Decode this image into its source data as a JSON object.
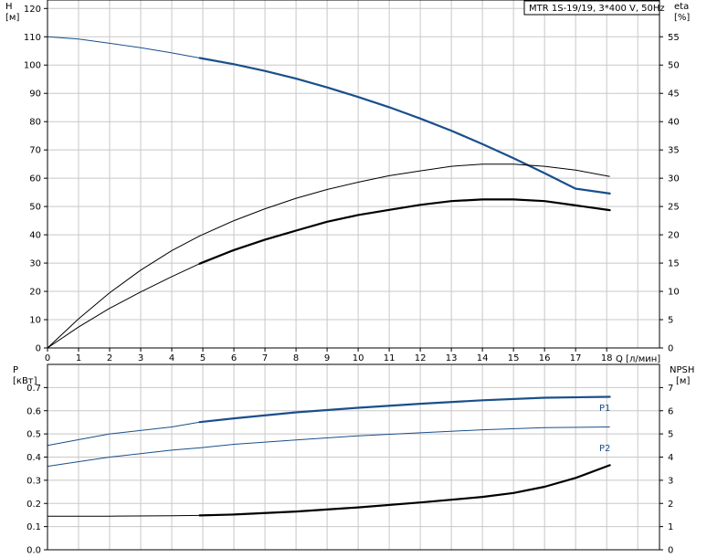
{
  "colors": {
    "blue": "#1a4f8b",
    "black": "#000000",
    "grid": "#c8c8c8",
    "frame": "#000000"
  },
  "title": "MTR 1S-19/19, 3*400 V, 50Hz",
  "chart_data": [
    {
      "type": "line",
      "grid": true,
      "x_axis": {
        "label": "Q [л/мин]",
        "range": [
          0,
          19.7
        ],
        "ticks": [
          "0",
          "1",
          "2",
          "3",
          "4",
          "5",
          "6",
          "7",
          "8",
          "9",
          "10",
          "11",
          "12",
          "13",
          "14",
          "15",
          "16",
          "17",
          "18"
        ]
      },
      "left_axis": {
        "label_line1": "H",
        "label_line2": "[м]",
        "range": [
          0,
          123
        ],
        "ticks": [
          "0",
          "10",
          "20",
          "30",
          "40",
          "50",
          "60",
          "70",
          "80",
          "90",
          "100",
          "110",
          "120"
        ]
      },
      "right_axis": {
        "label_line1": "eta",
        "label_line2": "[%]",
        "range": [
          0,
          61.5
        ],
        "ticks": [
          "0",
          "5",
          "10",
          "15",
          "20",
          "25",
          "30",
          "35",
          "40",
          "45",
          "50",
          "55"
        ]
      },
      "series": [
        {
          "axis": "left",
          "color": "#1a4f8b",
          "x": [
            0,
            1,
            2,
            3,
            4,
            4.9,
            6,
            7,
            8,
            9,
            10,
            11,
            12,
            13,
            14,
            15,
            16,
            17,
            18.1
          ],
          "y": [
            110,
            109.2,
            107.7,
            106.1,
            104.3,
            102.5,
            100.3,
            97.9,
            95.2,
            92.1,
            88.7,
            85.1,
            81.1,
            76.8,
            72.1,
            67.1,
            61.8,
            56.3,
            54.6
          ],
          "highlight_from": 4.9
        },
        {
          "axis": "left",
          "color": "#000000",
          "x": [
            0,
            1,
            2,
            3,
            4,
            4.9,
            6,
            7,
            8,
            9,
            10,
            11,
            12,
            13,
            14,
            15,
            16,
            17,
            18.1
          ],
          "y": [
            0,
            10.3,
            19.5,
            27.5,
            34.4,
            39.6,
            45.0,
            49.2,
            52.9,
            56.0,
            58.6,
            60.9,
            62.6,
            64.2,
            65.0,
            65.0,
            64.2,
            62.9,
            60.6
          ],
          "highlight_from": 99
        },
        {
          "axis": "left",
          "color": "#000000",
          "x": [
            0,
            1,
            2,
            3,
            4,
            4.9,
            6,
            7,
            8,
            9,
            10,
            11,
            12,
            13,
            14,
            15,
            16,
            17,
            18.1
          ],
          "y": [
            0,
            7.4,
            14.0,
            19.8,
            25.2,
            29.8,
            34.6,
            38.3,
            41.5,
            44.6,
            47.0,
            48.8,
            50.6,
            51.9,
            52.5,
            52.5,
            51.9,
            50.4,
            48.7
          ],
          "highlight_from": 4.9
        }
      ]
    },
    {
      "type": "line",
      "grid": true,
      "x_axis": {
        "range": [
          0,
          19.7
        ]
      },
      "left_axis": {
        "label_line1": "P",
        "label_line2": "[кВт]",
        "range": [
          0,
          0.8
        ],
        "ticks": [
          "0.0",
          "0.1",
          "0.2",
          "0.3",
          "0.4",
          "0.5",
          "0.6",
          "0.7"
        ]
      },
      "right_axis": {
        "label_line1": "NPSH",
        "label_line2": "[м]",
        "range": [
          0,
          8
        ],
        "ticks": [
          "0",
          "1",
          "2",
          "3",
          "4",
          "5",
          "6",
          "7"
        ]
      },
      "series": [
        {
          "name": "P1",
          "axis": "left",
          "color": "#1a4f8b",
          "x": [
            0,
            2,
            4,
            4.9,
            6,
            8,
            10,
            12,
            14,
            16,
            18.1
          ],
          "y": [
            0.45,
            0.5,
            0.53,
            0.551,
            0.567,
            0.593,
            0.613,
            0.63,
            0.645,
            0.656,
            0.66
          ],
          "highlight_from": 4.9
        },
        {
          "name": "P2",
          "axis": "left",
          "color": "#1a4f8b",
          "x": [
            0,
            2,
            4,
            4.9,
            6,
            8,
            10,
            12,
            14,
            16,
            18.1
          ],
          "y": [
            0.36,
            0.4,
            0.43,
            0.44,
            0.455,
            0.474,
            0.492,
            0.505,
            0.518,
            0.527,
            0.53
          ],
          "highlight_from": 99
        },
        {
          "axis": "right",
          "color": "#000000",
          "x": [
            0,
            2,
            4,
            4.9,
            6,
            8,
            10,
            12,
            13,
            14,
            15,
            16,
            17,
            18.1
          ],
          "y": [
            1.45,
            1.45,
            1.47,
            1.48,
            1.52,
            1.65,
            1.83,
            2.04,
            2.16,
            2.28,
            2.45,
            2.72,
            3.1,
            3.65
          ],
          "highlight_from": 4.9
        }
      ]
    }
  ]
}
